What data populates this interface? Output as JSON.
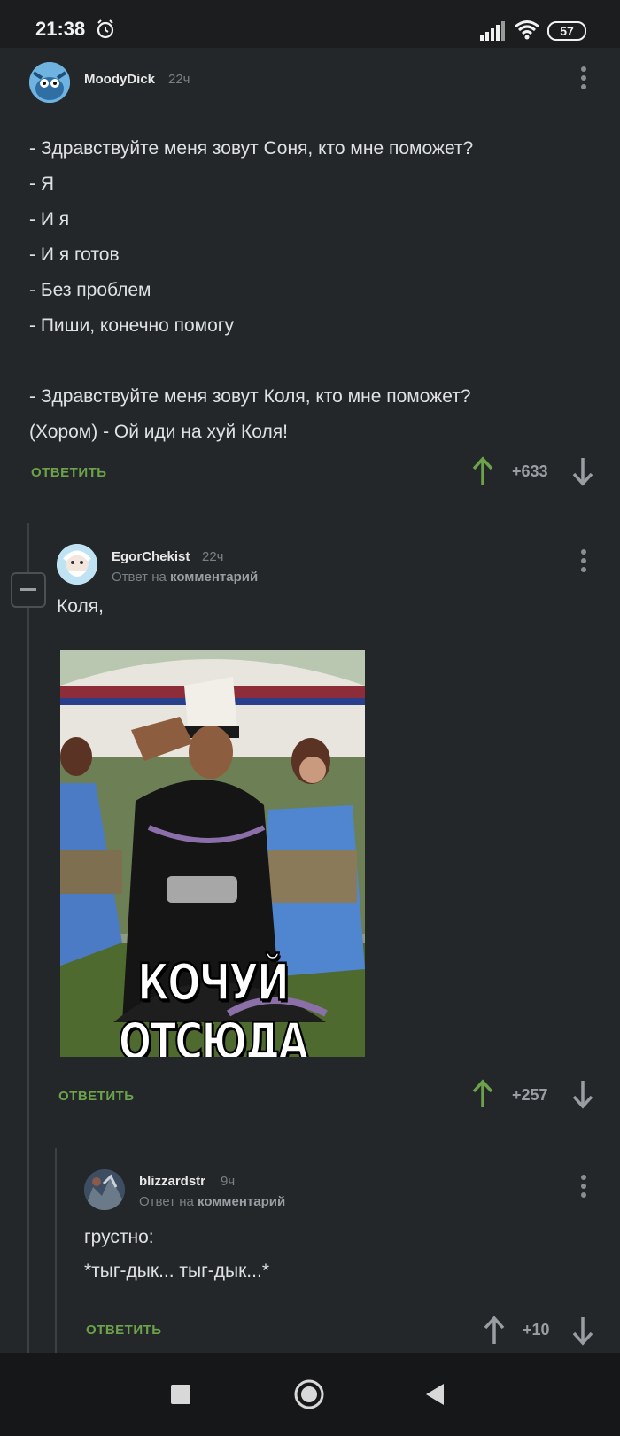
{
  "status_bar": {
    "time": "21:38",
    "battery": "57"
  },
  "comments": [
    {
      "author": "MoodyDick",
      "time": "22ч",
      "lines": [
        "- Здравствуйте меня зовут Соня, кто мне поможет?",
        "- Я",
        "- И я",
        "- И я готов",
        "- Без проблем",
        "- Пиши, конечно помогу",
        "",
        "- Здравствуйте меня зовут Коля, кто мне поможет?",
        "(Хором) - Ой иди на хуй Коля!"
      ],
      "reply_label": "ОТВЕТИТЬ",
      "score": "+633"
    },
    {
      "author": "EgorChekist",
      "time": "22ч",
      "reply_to_prefix": "Ответ на",
      "reply_to_target": "комментарий",
      "text": "Коля,",
      "image_caption": "КОЧУЙ ОТСЮДА",
      "reply_label": "ОТВЕТИТЬ",
      "score": "+257"
    },
    {
      "author": "blizzardstr",
      "time": "9ч",
      "reply_to_prefix": "Ответ на",
      "reply_to_target": "комментарий",
      "lines": [
        "грустно:",
        "*тыг-дык... тыг-дык...*"
      ],
      "reply_label": "ОТВЕТИТЬ",
      "score": "+10"
    }
  ],
  "colors": {
    "upvote": "#6ca34a",
    "background": "#24272a",
    "text": "#d7dadc"
  }
}
